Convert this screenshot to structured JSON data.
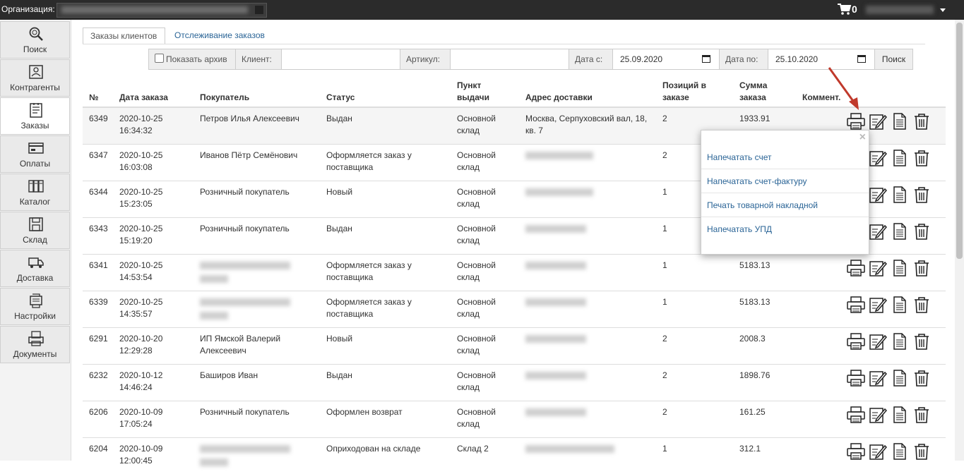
{
  "topbar": {
    "org_label": "Организация:",
    "cart_count": "0"
  },
  "sidebar": {
    "items": [
      {
        "label": "Поиск",
        "icon": "search-icon"
      },
      {
        "label": "Контрагенты",
        "icon": "contacts-icon"
      },
      {
        "label": "Заказы",
        "icon": "orders-icon"
      },
      {
        "label": "Оплаты",
        "icon": "payments-icon"
      },
      {
        "label": "Каталог",
        "icon": "catalog-icon"
      },
      {
        "label": "Склад",
        "icon": "warehouse-icon"
      },
      {
        "label": "Доставка",
        "icon": "delivery-icon"
      },
      {
        "label": "Настройки",
        "icon": "settings-icon"
      },
      {
        "label": "Документы",
        "icon": "documents-icon"
      }
    ]
  },
  "tabs": {
    "customer_orders": "Заказы клиентов",
    "tracking": "Отслеживание заказов"
  },
  "filters": {
    "archive": "Показать архив",
    "client": "Клиент:",
    "article": "Артикул:",
    "date_from_label": "Дата с:",
    "date_from": "25.09.2020",
    "date_to_label": "Дата по:",
    "date_to": "25.10.2020",
    "search": "Поиск"
  },
  "table": {
    "headers": {
      "num": "№",
      "date": "Дата заказа",
      "buyer": "Покупатель",
      "status": "Статус",
      "pickup": "Пункт выдачи",
      "address": "Адрес доставки",
      "positions": "Позиций в заказе",
      "sum": "Сумма заказа",
      "comment": "Коммент."
    },
    "rows": [
      {
        "num": "6349",
        "date": "2020-10-25",
        "time": "16:34:32",
        "buyer": "Петров Илья Алексеевич",
        "status": "Выдан",
        "pickup": "Основной склад",
        "address": "Москва, Серпуховский вал, 18, кв. 7",
        "positions": "2",
        "sum": "1933.91"
      },
      {
        "num": "6347",
        "date": "2020-10-25",
        "time": "16:03:08",
        "buyer": "Иванов Пётр Семёнович",
        "status": "Оформляется заказ у поставщика",
        "pickup": "Основной склад",
        "address": "",
        "positions": "2",
        "sum": ""
      },
      {
        "num": "6344",
        "date": "2020-10-25",
        "time": "15:23:05",
        "buyer": "Розничный покупатель",
        "status": "Новый",
        "pickup": "Основной склад",
        "address": "",
        "positions": "1",
        "sum": ""
      },
      {
        "num": "6343",
        "date": "2020-10-25",
        "time": "15:19:20",
        "buyer": "Розничный покупатель",
        "status": "Выдан",
        "pickup": "Основной склад",
        "address": "",
        "positions": "1",
        "sum": ""
      },
      {
        "num": "6341",
        "date": "2020-10-25",
        "time": "14:53:54",
        "buyer": "",
        "status": "Оформляется заказ у поставщика",
        "pickup": "Основной склад",
        "address": "",
        "positions": "1",
        "sum": "5183.13"
      },
      {
        "num": "6339",
        "date": "2020-10-25",
        "time": "14:35:57",
        "buyer": "",
        "status": "Оформляется заказ у поставщика",
        "pickup": "Основной склад",
        "address": "",
        "positions": "1",
        "sum": "5183.13"
      },
      {
        "num": "6291",
        "date": "2020-10-20",
        "time": "12:29:28",
        "buyer": "ИП Ямской Валерий Алексеевич",
        "status": "Новый",
        "pickup": "Основной склад",
        "address": "",
        "positions": "2",
        "sum": "2008.3"
      },
      {
        "num": "6232",
        "date": "2020-10-12",
        "time": "14:46:24",
        "buyer": "Баширов Иван",
        "status": "Выдан",
        "pickup": "Основной склад",
        "address": "",
        "positions": "2",
        "sum": "1898.76"
      },
      {
        "num": "6206",
        "date": "2020-10-09",
        "time": "17:05:24",
        "buyer": "Розничный покупатель",
        "status": "Оформлен возврат",
        "pickup": "Основной склад",
        "address": "",
        "positions": "2",
        "sum": "161.25"
      },
      {
        "num": "6204",
        "date": "2020-10-09",
        "time": "12:00:45",
        "buyer": "",
        "status": "Оприходован на складе",
        "pickup": "Склад 2",
        "address": "",
        "positions": "1",
        "sum": "312.1"
      }
    ]
  },
  "popup": {
    "close": "×",
    "items": [
      "Напечатать счет",
      "Напечатать счет-фактуру",
      "Печать товарной накладной",
      "Напечатать УПД"
    ]
  },
  "colors": {
    "topbar": "#2b2b2b",
    "link": "#2a6496",
    "arrow": "#c0392b"
  }
}
